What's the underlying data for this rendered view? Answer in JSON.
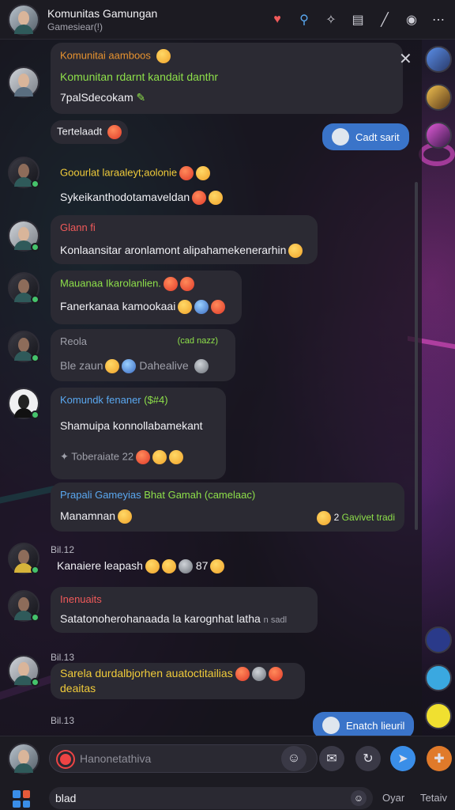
{
  "header": {
    "title": "Komunitas Gamungan",
    "subtitle": "Gamesiear(!)"
  },
  "pinned": {
    "sender": "Komunitai aamboos",
    "line1": "Komunitan rdarnt kandait danthr",
    "line2": "7palSdecokam"
  },
  "messages": [
    {
      "label": "Tertelaadt"
    },
    {
      "outgoing": "Cadt sarit"
    },
    {
      "sender": "Goourlat laraaleyt;aolonie",
      "text": "Sykeikanthodotamaveldan"
    },
    {
      "sender": "Glann fi",
      "text": "Konlaansitar aronlamont alipahamekenerarhin"
    },
    {
      "sender": "Mauanaa Ikarolanlien.",
      "text": "Fanerkanaa kamookaai"
    },
    {
      "sender": "Reola",
      "time": "(cad nazz)",
      "text": "Ble zaun",
      "tail": "Dahealive"
    },
    {
      "sender": "Komundk fenaner",
      "tag": "($#4)",
      "text": "Shamuipa konnollabamekant",
      "reaction_label": "Toberaiate",
      "reaction_count": "22"
    },
    {
      "sender": "Prapali Gameyias",
      "sender2": "Bhat Gamah",
      "tag": "(camelaac)",
      "text": "Manamnan",
      "side": "Gavivet tradi",
      "side_num": "2"
    },
    {
      "time": "Bil.12",
      "text": "Kanaiere leapash",
      "count": "87"
    },
    {
      "sender": "Inenuaits",
      "text": "Satatonoherohanaada la karognhat latha",
      "time": "n sadl"
    },
    {
      "time": "Bil.13",
      "sender": "Sarela durdalbjorhen auatoctitailias",
      "text": "deaitas"
    },
    {
      "time": "Bil.13",
      "outgoing": "Enatch lieuril"
    }
  ],
  "composer": {
    "placeholder": "Hanonetathiva",
    "value": "blad",
    "right1": "Oyar",
    "right2": "Tetaiv"
  }
}
